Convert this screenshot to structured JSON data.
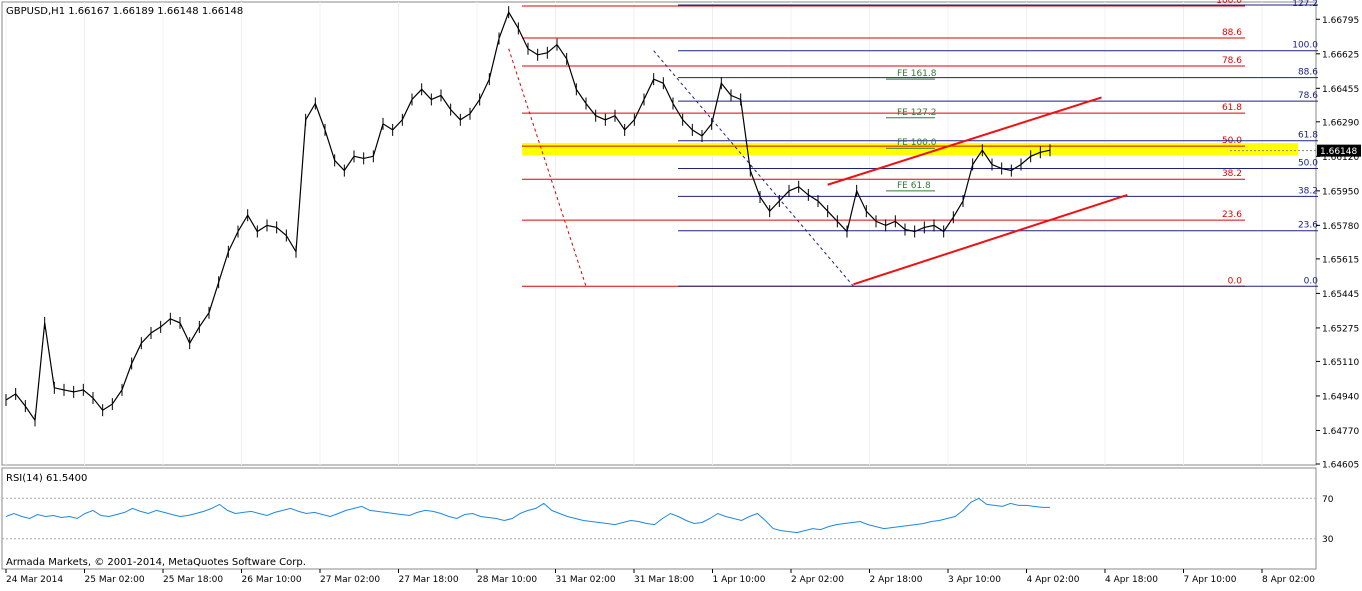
{
  "header": {
    "title": "GBPUSD,H1  1.66167 1.66189 1.66148 1.66148"
  },
  "footer": {
    "copyright": "Armada Markets, © 2001-2014, MetaQuotes Software Corp."
  },
  "rsi": {
    "title": "RSI(14) 61.5400",
    "levels": [
      70,
      30
    ],
    "ymin": 0,
    "ymax": 100,
    "tick_labels": [
      "70",
      "30"
    ]
  },
  "price_axis": {
    "ymin": 1.646,
    "ymax": 1.6688,
    "ticks": [
      "1.66795",
      "1.66625",
      "1.66455",
      "1.66290",
      "1.66120",
      "1.65950",
      "1.65780",
      "1.65615",
      "1.65445",
      "1.65275",
      "1.65110",
      "1.64940",
      "1.64770",
      "1.64605"
    ],
    "current_price_label": "1.66148",
    "current_price": 1.66148
  },
  "time_axis": {
    "labels": [
      "24 Mar 2014",
      "25 Mar 02:00",
      "25 Mar 18:00",
      "26 Mar 10:00",
      "27 Mar 02:00",
      "27 Mar 18:00",
      "28 Mar 10:00",
      "31 Mar 02:00",
      "31 Mar 18:00",
      "1 Apr 10:00",
      "2 Apr 02:00",
      "2 Apr 18:00",
      "3 Apr 10:00",
      "4 Apr 02:00",
      "4 Apr 18:00",
      "7 Apr 10:00",
      "8 Apr 02:00"
    ]
  },
  "fib_retracement_1": {
    "color": "#e00000",
    "high": 1.6686,
    "low": 1.6548,
    "levels": [
      {
        "label": "100.0",
        "ratio": 1.0
      },
      {
        "label": "88.6",
        "ratio": 0.886
      },
      {
        "label": "78.6",
        "ratio": 0.786
      },
      {
        "label": "61.8",
        "ratio": 0.618
      },
      {
        "label": "50.0",
        "ratio": 0.5
      },
      {
        "label": "38.2",
        "ratio": 0.382
      },
      {
        "label": "23.6",
        "ratio": 0.236
      },
      {
        "label": "0.0",
        "ratio": 0.0
      }
    ]
  },
  "fib_retracement_2": {
    "color": "#1a237e",
    "high": 1.6664,
    "low": 1.6548,
    "levels": [
      {
        "label": "100.0",
        "ratio": 1.0
      },
      {
        "label": "88.6",
        "ratio": 0.886
      },
      {
        "label": "78.6",
        "ratio": 0.786
      },
      {
        "label": "61.8",
        "ratio": 0.618
      },
      {
        "label": "50.0",
        "ratio": 0.5
      },
      {
        "label": "38.2",
        "ratio": 0.382
      },
      {
        "label": "23.6",
        "ratio": 0.236
      },
      {
        "label": "0.0",
        "ratio": 0.0
      }
    ],
    "top_label": "127.2"
  },
  "fib_expansion": {
    "color": "#2e7d32",
    "levels": [
      {
        "label": "FE 161.8",
        "price": 1.665
      },
      {
        "label": "FE 127.2",
        "price": 1.6631
      },
      {
        "label": "FE 100.0",
        "price": 1.6616
      },
      {
        "label": "FE 61.8",
        "price": 1.6595
      }
    ]
  },
  "highlight_zone": {
    "color": "#ffff00",
    "price_top": 1.66185,
    "price_bottom": 1.66125
  },
  "channel": {
    "color": "#ee1111",
    "upper": [
      {
        "t": 255,
        "p": 1.6598
      },
      {
        "t": 340,
        "p": 1.6641
      }
    ],
    "lower": [
      {
        "t": 263,
        "p": 1.6549
      },
      {
        "t": 348,
        "p": 1.6593
      }
    ]
  },
  "price_series": {
    "note_hidden": "",
    "points": [
      [
        0,
        1.6492
      ],
      [
        3,
        1.6495
      ],
      [
        6,
        1.6489
      ],
      [
        9,
        1.6482
      ],
      [
        12,
        1.653
      ],
      [
        15,
        1.6498
      ],
      [
        18,
        1.6497
      ],
      [
        21,
        1.6496
      ],
      [
        24,
        1.6497
      ],
      [
        27,
        1.6493
      ],
      [
        30,
        1.6487
      ],
      [
        33,
        1.649
      ],
      [
        36,
        1.6497
      ],
      [
        39,
        1.651
      ],
      [
        42,
        1.652
      ],
      [
        45,
        1.6525
      ],
      [
        48,
        1.6528
      ],
      [
        51,
        1.6532
      ],
      [
        54,
        1.653
      ],
      [
        57,
        1.652
      ],
      [
        60,
        1.6528
      ],
      [
        63,
        1.6535
      ],
      [
        66,
        1.655
      ],
      [
        69,
        1.6565
      ],
      [
        72,
        1.6575
      ],
      [
        75,
        1.6583
      ],
      [
        78,
        1.6575
      ],
      [
        81,
        1.6578
      ],
      [
        84,
        1.6577
      ],
      [
        87,
        1.6573
      ],
      [
        90,
        1.6565
      ],
      [
        93,
        1.663
      ],
      [
        96,
        1.6638
      ],
      [
        99,
        1.6625
      ],
      [
        102,
        1.661
      ],
      [
        105,
        1.6605
      ],
      [
        108,
        1.6612
      ],
      [
        111,
        1.6611
      ],
      [
        114,
        1.6612
      ],
      [
        117,
        1.6628
      ],
      [
        120,
        1.6625
      ],
      [
        123,
        1.663
      ],
      [
        126,
        1.664
      ],
      [
        129,
        1.6645
      ],
      [
        132,
        1.664
      ],
      [
        135,
        1.6642
      ],
      [
        138,
        1.6635
      ],
      [
        141,
        1.663
      ],
      [
        144,
        1.6633
      ],
      [
        147,
        1.664
      ],
      [
        150,
        1.665
      ],
      [
        153,
        1.667
      ],
      [
        156,
        1.6683
      ],
      [
        159,
        1.6675
      ],
      [
        162,
        1.6665
      ],
      [
        165,
        1.6662
      ],
      [
        168,
        1.6663
      ],
      [
        171,
        1.6667
      ],
      [
        174,
        1.666
      ],
      [
        177,
        1.6645
      ],
      [
        180,
        1.6638
      ],
      [
        183,
        1.6632
      ],
      [
        186,
        1.663
      ],
      [
        189,
        1.6632
      ],
      [
        192,
        1.6625
      ],
      [
        195,
        1.663
      ],
      [
        198,
        1.664
      ],
      [
        201,
        1.665
      ],
      [
        204,
        1.6648
      ],
      [
        207,
        1.6638
      ],
      [
        210,
        1.663
      ],
      [
        213,
        1.6625
      ],
      [
        216,
        1.6622
      ],
      [
        219,
        1.6628
      ],
      [
        222,
        1.6648
      ],
      [
        225,
        1.6642
      ],
      [
        228,
        1.664
      ],
      [
        231,
        1.6605
      ],
      [
        234,
        1.6592
      ],
      [
        237,
        1.6585
      ],
      [
        240,
        1.659
      ],
      [
        243,
        1.6595
      ],
      [
        246,
        1.6597
      ],
      [
        249,
        1.6593
      ],
      [
        252,
        1.659
      ],
      [
        255,
        1.6585
      ],
      [
        258,
        1.658
      ],
      [
        261,
        1.6575
      ],
      [
        264,
        1.6595
      ],
      [
        267,
        1.6585
      ],
      [
        270,
        1.658
      ],
      [
        273,
        1.6578
      ],
      [
        276,
        1.658
      ],
      [
        279,
        1.6576
      ],
      [
        282,
        1.6575
      ],
      [
        285,
        1.6577
      ],
      [
        288,
        1.6578
      ],
      [
        291,
        1.6575
      ],
      [
        294,
        1.6582
      ],
      [
        297,
        1.659
      ],
      [
        300,
        1.6608
      ],
      [
        303,
        1.6615
      ],
      [
        306,
        1.6608
      ],
      [
        309,
        1.6606
      ],
      [
        312,
        1.6605
      ],
      [
        315,
        1.6608
      ],
      [
        318,
        1.6612
      ],
      [
        321,
        1.6614
      ],
      [
        324,
        1.6615
      ]
    ]
  },
  "rsi_series": [
    52,
    55,
    52,
    50,
    54,
    52,
    53,
    51,
    52,
    50,
    55,
    58,
    53,
    52,
    54,
    56,
    60,
    57,
    55,
    58,
    56,
    54,
    52,
    53,
    55,
    57,
    60,
    64,
    58,
    55,
    56,
    57,
    55,
    53,
    56,
    58,
    60,
    57,
    55,
    56,
    54,
    52,
    55,
    58,
    60,
    62,
    58,
    57,
    56,
    55,
    54,
    53,
    56,
    58,
    57,
    55,
    52,
    50,
    54,
    55,
    52,
    51,
    50,
    48,
    50,
    55,
    58,
    60,
    65,
    58,
    55,
    52,
    50,
    48,
    47,
    46,
    45,
    44,
    46,
    48,
    47,
    45,
    44,
    50,
    55,
    52,
    48,
    45,
    46,
    50,
    55,
    52,
    50,
    48,
    52,
    55,
    48,
    40,
    38,
    37,
    36,
    38,
    40,
    39,
    42,
    44,
    45,
    46,
    47,
    44,
    42,
    40,
    41,
    42,
    43,
    44,
    45,
    47,
    48,
    50,
    52,
    58,
    66,
    70,
    64,
    63,
    62,
    65,
    63,
    63,
    62,
    61,
    61
  ]
}
